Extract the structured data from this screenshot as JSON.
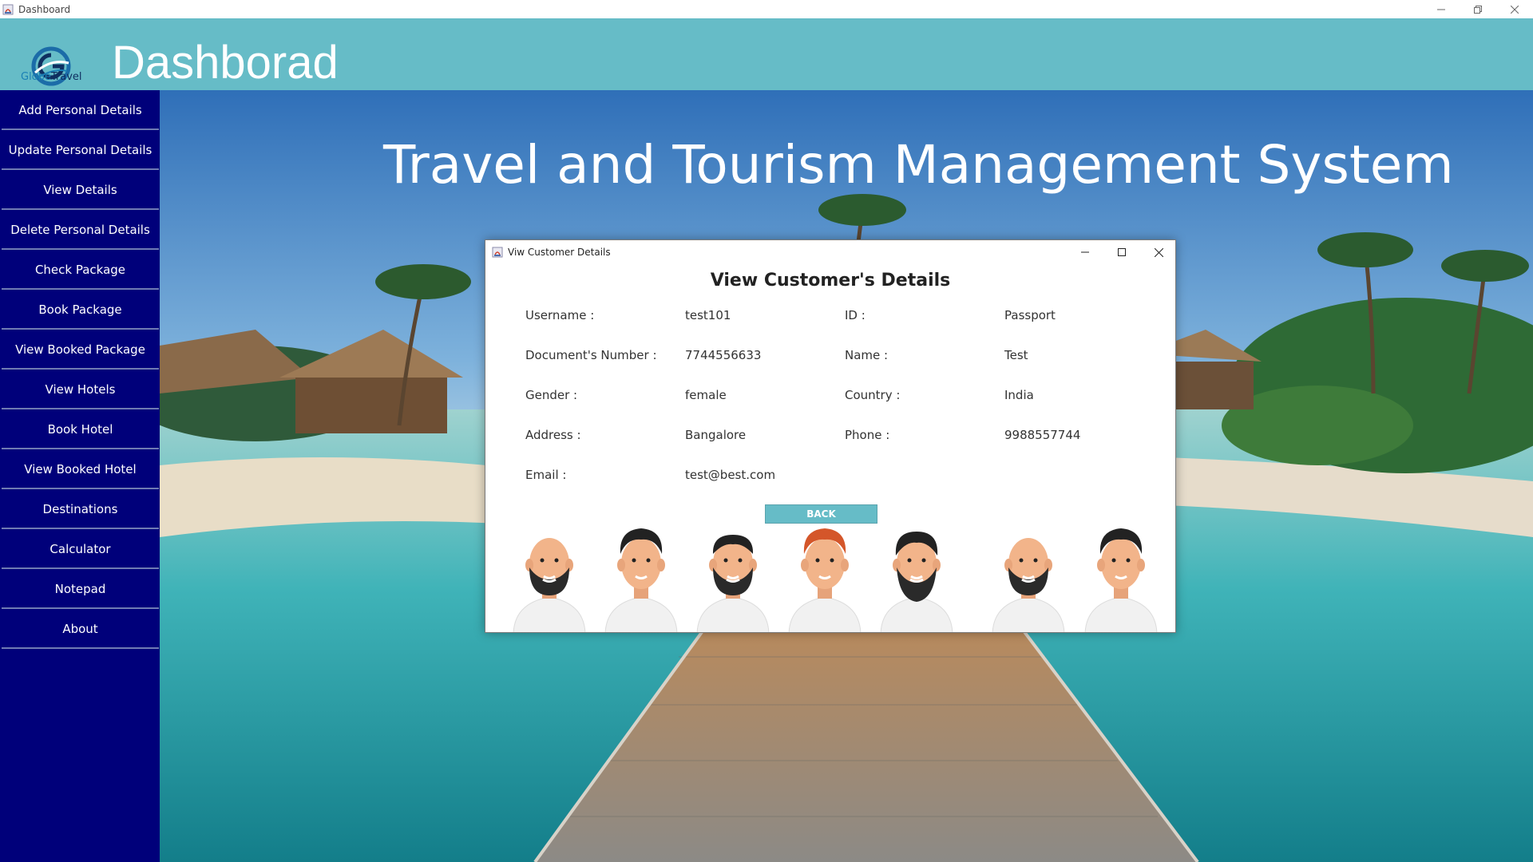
{
  "window": {
    "title": "Dashboard"
  },
  "header": {
    "title": "Dashborad",
    "logo_text_1": "Globe",
    "logo_text_2": "Travel"
  },
  "sidebar": {
    "items": [
      {
        "label": "Add Personal Details"
      },
      {
        "label": "Update Personal Details"
      },
      {
        "label": "View Details"
      },
      {
        "label": "Delete Personal Details"
      },
      {
        "label": "Check Package"
      },
      {
        "label": "Book Package"
      },
      {
        "label": "View Booked Package"
      },
      {
        "label": "View Hotels"
      },
      {
        "label": "Book Hotel"
      },
      {
        "label": "View Booked Hotel"
      },
      {
        "label": "Destinations"
      },
      {
        "label": "Calculator"
      },
      {
        "label": "Notepad"
      },
      {
        "label": "About"
      }
    ]
  },
  "scene": {
    "title": "Travel and Tourism Management System"
  },
  "dialog": {
    "title": "Viw Customer Details",
    "heading": "View Customer's Details",
    "fields": {
      "username": {
        "label": "Username  :",
        "value": "test101"
      },
      "id": {
        "label": "ID  :",
        "value": "Passport"
      },
      "doc_number": {
        "label": "Document's Number  :",
        "value": "7744556633"
      },
      "name": {
        "label": "Name  :",
        "value": "Test"
      },
      "gender": {
        "label": "Gender  :",
        "value": "female"
      },
      "country": {
        "label": "Country  :",
        "value": "India"
      },
      "address": {
        "label": "Address  :",
        "value": "Bangalore"
      },
      "phone": {
        "label": "Phone  :",
        "value": "9988557744"
      },
      "email": {
        "label": "Email  :",
        "value": "test@best.com"
      }
    },
    "back_label": "BACK"
  },
  "colors": {
    "header": "#66bcc7",
    "sidebar": "#00007a",
    "accent": "#66bcc7"
  }
}
